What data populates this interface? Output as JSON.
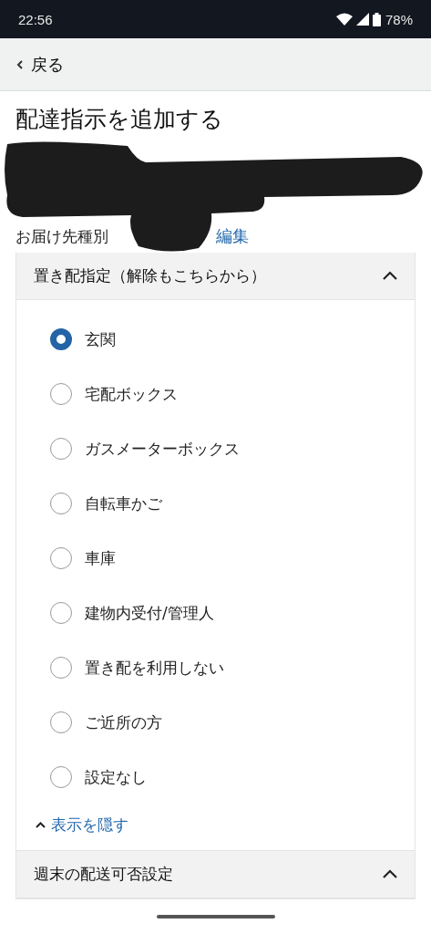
{
  "status_bar": {
    "time": "22:56",
    "battery": "78%"
  },
  "nav": {
    "back": "戻る"
  },
  "title": "配達指示を追加する",
  "destination": {
    "label": "お届け先種別",
    "edit_link": "編集"
  },
  "sections": [
    {
      "title": "置き配指定（解除もこちらから）",
      "expanded": true,
      "options": [
        {
          "label": "玄関",
          "selected": true
        },
        {
          "label": "宅配ボックス",
          "selected": false
        },
        {
          "label": "ガスメーターボックス",
          "selected": false
        },
        {
          "label": "自転車かご",
          "selected": false
        },
        {
          "label": "車庫",
          "selected": false
        },
        {
          "label": "建物内受付/管理人",
          "selected": false
        },
        {
          "label": "置き配を利用しない",
          "selected": false
        },
        {
          "label": "ご近所の方",
          "selected": false
        },
        {
          "label": "設定なし",
          "selected": false
        }
      ],
      "hide_link": "表示を隠す"
    },
    {
      "title": "週末の配送可否設定",
      "expanded": true
    }
  ]
}
